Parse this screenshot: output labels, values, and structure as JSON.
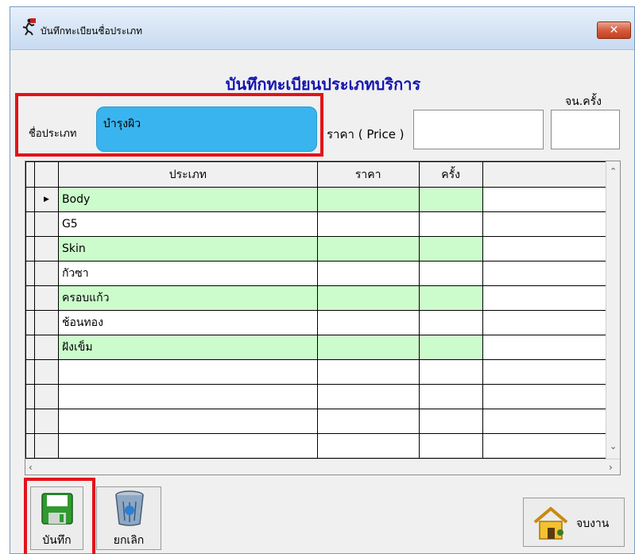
{
  "window": {
    "title": "บันทึกทะเบียนชื่อประเภท",
    "close_label": "✕"
  },
  "form": {
    "heading": "บันทึกทะเบียนประเภทบริการ",
    "count_label": "จน.ครั้ง",
    "name_label": "ชื่อประเภท",
    "name_value": "บำรุงผิว",
    "price_label": "ราคา ( Price )",
    "price_value": "",
    "count_value": ""
  },
  "grid": {
    "columns": [
      "ประเภท",
      "ราคา",
      "ครั้ง"
    ],
    "current_row_marker": "▶",
    "rows": [
      [
        "Body",
        "",
        ""
      ],
      [
        "G5",
        "",
        ""
      ],
      [
        "Skin",
        "",
        ""
      ],
      [
        "กัวซา",
        "",
        ""
      ],
      [
        "ครอบแก้ว",
        "",
        ""
      ],
      [
        "ช้อนทอง",
        "",
        ""
      ],
      [
        "ฝังเข็ม",
        "",
        ""
      ],
      [
        "",
        "",
        ""
      ],
      [
        "",
        "",
        ""
      ],
      [
        "",
        "",
        ""
      ],
      [
        "",
        "",
        ""
      ]
    ],
    "scroll_up": "⌃",
    "scroll_down": "⌄",
    "scroll_left": "‹",
    "scroll_right": "›"
  },
  "buttons": {
    "save_label": "บันทึก",
    "cancel_label": "ยกเลิก",
    "exit_label": "จบงาน"
  },
  "icons": {
    "title": "running-man-icon",
    "save": "floppy-disk-icon",
    "cancel": "recycle-bin-icon",
    "exit": "house-exit-icon"
  },
  "colors": {
    "heading": "#1515b0",
    "name_field": "#3ab4ee",
    "row_highlight": "#ccfccc",
    "annotation": "#e1141a"
  }
}
